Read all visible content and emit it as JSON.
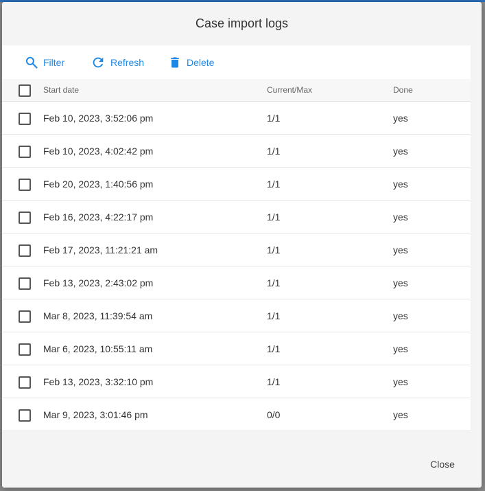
{
  "dialog": {
    "title": "Case import logs",
    "close_label": "Close"
  },
  "toolbar": {
    "filter_label": "Filter",
    "refresh_label": "Refresh",
    "delete_label": "Delete",
    "filter_icon": "search-icon",
    "refresh_icon": "refresh-icon",
    "delete_icon": "trash-icon",
    "accent_color": "#1e88e5"
  },
  "table": {
    "columns": [
      "Start date",
      "Current/Max",
      "Done"
    ],
    "rows": [
      {
        "start_date": "Feb 10, 2023, 3:52:06 pm",
        "current_max": "1/1",
        "done": "yes"
      },
      {
        "start_date": "Feb 10, 2023, 4:02:42 pm",
        "current_max": "1/1",
        "done": "yes"
      },
      {
        "start_date": "Feb 20, 2023, 1:40:56 pm",
        "current_max": "1/1",
        "done": "yes"
      },
      {
        "start_date": "Feb 16, 2023, 4:22:17 pm",
        "current_max": "1/1",
        "done": "yes"
      },
      {
        "start_date": "Feb 17, 2023, 11:21:21 am",
        "current_max": "1/1",
        "done": "yes"
      },
      {
        "start_date": "Feb 13, 2023, 2:43:02 pm",
        "current_max": "1/1",
        "done": "yes"
      },
      {
        "start_date": "Mar 8, 2023, 11:39:54 am",
        "current_max": "1/1",
        "done": "yes"
      },
      {
        "start_date": "Mar 6, 2023, 10:55:11 am",
        "current_max": "1/1",
        "done": "yes"
      },
      {
        "start_date": "Feb 13, 2023, 3:32:10 pm",
        "current_max": "1/1",
        "done": "yes"
      },
      {
        "start_date": "Mar 9, 2023, 3:01:46 pm",
        "current_max": "0/0",
        "done": "yes"
      }
    ]
  }
}
